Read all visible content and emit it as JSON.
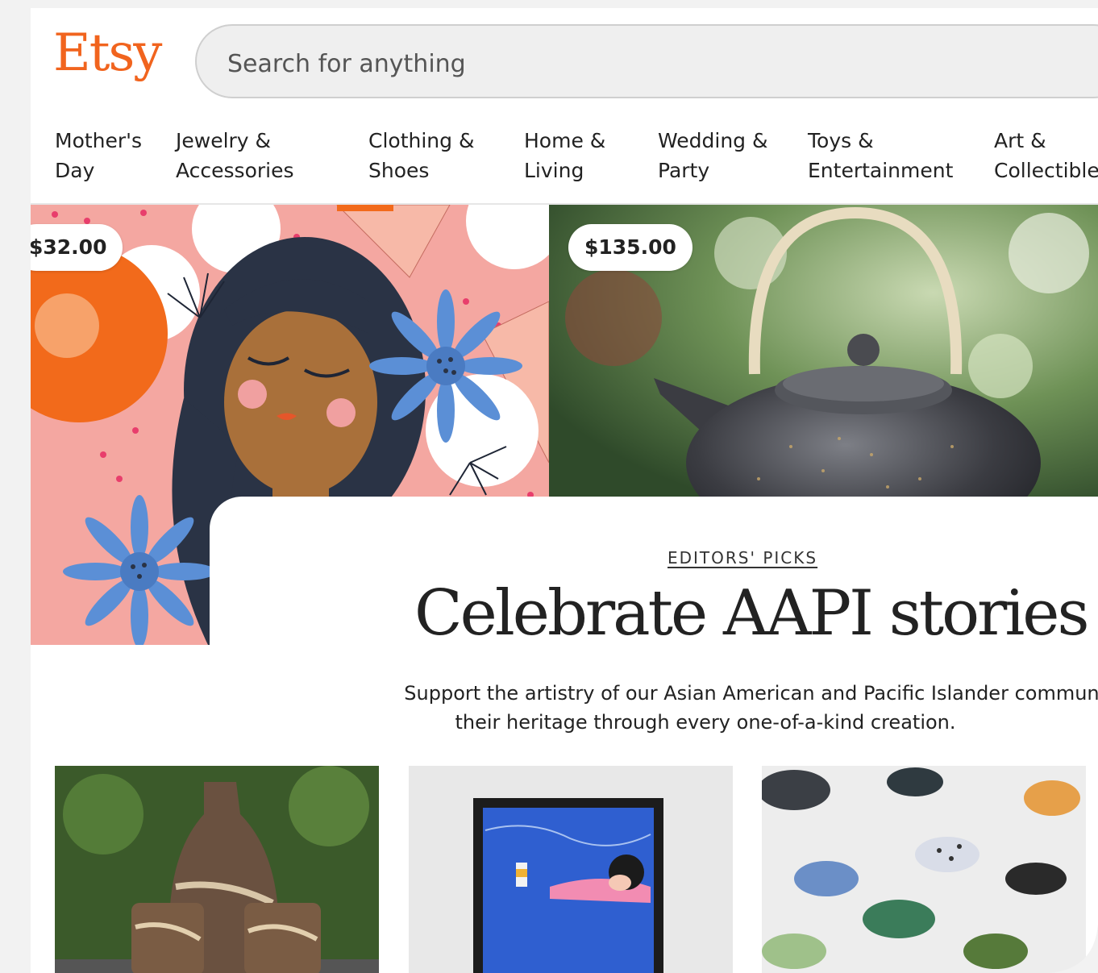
{
  "header": {
    "logo": "Etsy",
    "search_placeholder": "Search for anything"
  },
  "nav": {
    "items": [
      {
        "line1": "Mother's",
        "line2": "Day"
      },
      {
        "line1": "Jewelry &",
        "line2": "Accessories"
      },
      {
        "line1": "Clothing &",
        "line2": "Shoes"
      },
      {
        "line1": "Home &",
        "line2": "Living"
      },
      {
        "line1": "Wedding &",
        "line2": "Party"
      },
      {
        "line1": "Toys &",
        "line2": "Entertainment"
      },
      {
        "line1": "Art &",
        "line2": "Collectibles"
      }
    ]
  },
  "hero": {
    "left_price": "$32.00",
    "right_price": "$135.00",
    "kicker": "EDITORS' PICKS",
    "headline": "Celebrate AAPI stories",
    "subtext_line1": "Support the artistry of our Asian American and Pacific Islander community, who",
    "subtext_line2": "their heritage through every one-of-a-kind creation."
  },
  "colors": {
    "brand": "#f1641e",
    "text": "#222222",
    "background": "#ffffff"
  }
}
